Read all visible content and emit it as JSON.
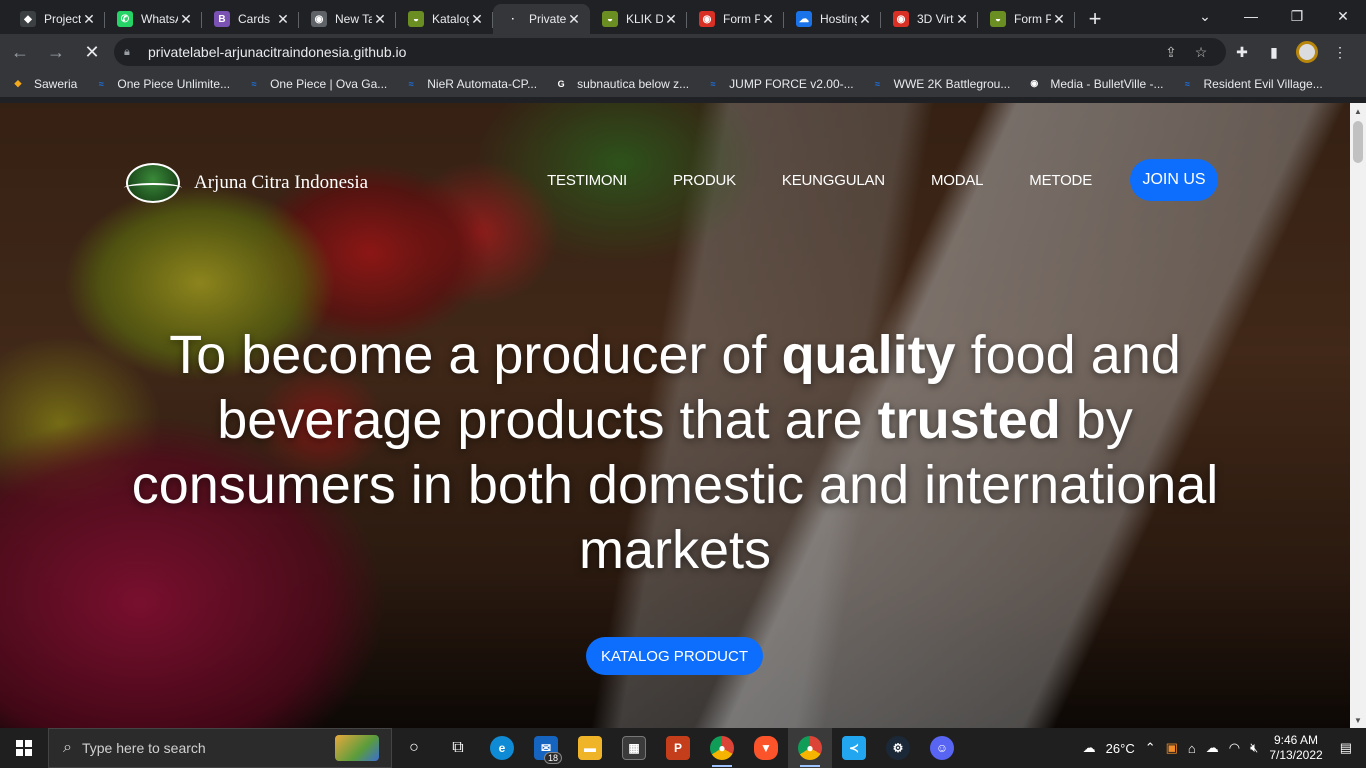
{
  "browser": {
    "tabs": [
      {
        "title": "Project",
        "fav_color": "#3c4043",
        "fav_glyph": "◆"
      },
      {
        "title": "WhatsApp",
        "fav_color": "#25d366",
        "fav_glyph": "✆"
      },
      {
        "title": "Cards",
        "fav_color": "#7952b3",
        "fav_glyph": "B"
      },
      {
        "title": "New Tab",
        "fav_color": "#5f6368",
        "fav_glyph": "◉"
      },
      {
        "title": "Katalog",
        "fav_color": "#6b8e23",
        "fav_glyph": "◒"
      },
      {
        "title": "Private",
        "fav_color": "#35363a",
        "fav_glyph": "·",
        "active": true
      },
      {
        "title": "KLIK D",
        "fav_color": "#6b8e23",
        "fav_glyph": "◒"
      },
      {
        "title": "Form P",
        "fav_color": "#d93025",
        "fav_glyph": "◉"
      },
      {
        "title": "Hosting",
        "fav_color": "#1a73e8",
        "fav_glyph": "☁"
      },
      {
        "title": "3D Virt",
        "fav_color": "#d93025",
        "fav_glyph": "◉"
      },
      {
        "title": "Form P",
        "fav_color": "#6b8e23",
        "fav_glyph": "◒"
      }
    ],
    "url": "privatelabel-arjunacitraindonesia.github.io",
    "bookmarks": [
      {
        "label": "Saweria",
        "fav_color": "#f4a91c",
        "fav_glyph": "◆"
      },
      {
        "label": "One Piece Unlimite...",
        "fav_color": "#1a73e8",
        "fav_glyph": "≈"
      },
      {
        "label": "One Piece | Ova Ga...",
        "fav_color": "#1a73e8",
        "fav_glyph": "≈"
      },
      {
        "label": "NieR Automata-CP...",
        "fav_color": "#1a73e8",
        "fav_glyph": "≈"
      },
      {
        "label": "subnautica below z...",
        "fav_color": "#ffffff",
        "fav_glyph": "G"
      },
      {
        "label": "JUMP FORCE v2.00-...",
        "fav_color": "#1a73e8",
        "fav_glyph": "≈"
      },
      {
        "label": "WWE 2K Battlegrou...",
        "fav_color": "#1a73e8",
        "fav_glyph": "≈"
      },
      {
        "label": "Media - BulletVille -...",
        "fav_color": "#ffffff",
        "fav_glyph": "◉"
      },
      {
        "label": "Resident Evil Village...",
        "fav_color": "#1a73e8",
        "fav_glyph": "≈"
      }
    ]
  },
  "site": {
    "brand": "Arjuna Citra Indonesia",
    "nav": [
      "TESTIMONI",
      "PRODUK",
      "KEUNGGULAN",
      "MODAL",
      "METODE"
    ],
    "join": "JOIN US",
    "hero": {
      "part1": "To become a producer of ",
      "bold1": "quality",
      "part2": " food and beverage products that are ",
      "bold2": "trusted",
      "part3": " by consumers in both domestic and international markets"
    },
    "cta": "KATALOG PRODUCT",
    "accent": "#0d6efd"
  },
  "taskbar": {
    "search_placeholder": "Type here to search",
    "mail_badge": "18",
    "weather": "26°C",
    "time": "9:46 AM",
    "date": "7/13/2022"
  }
}
